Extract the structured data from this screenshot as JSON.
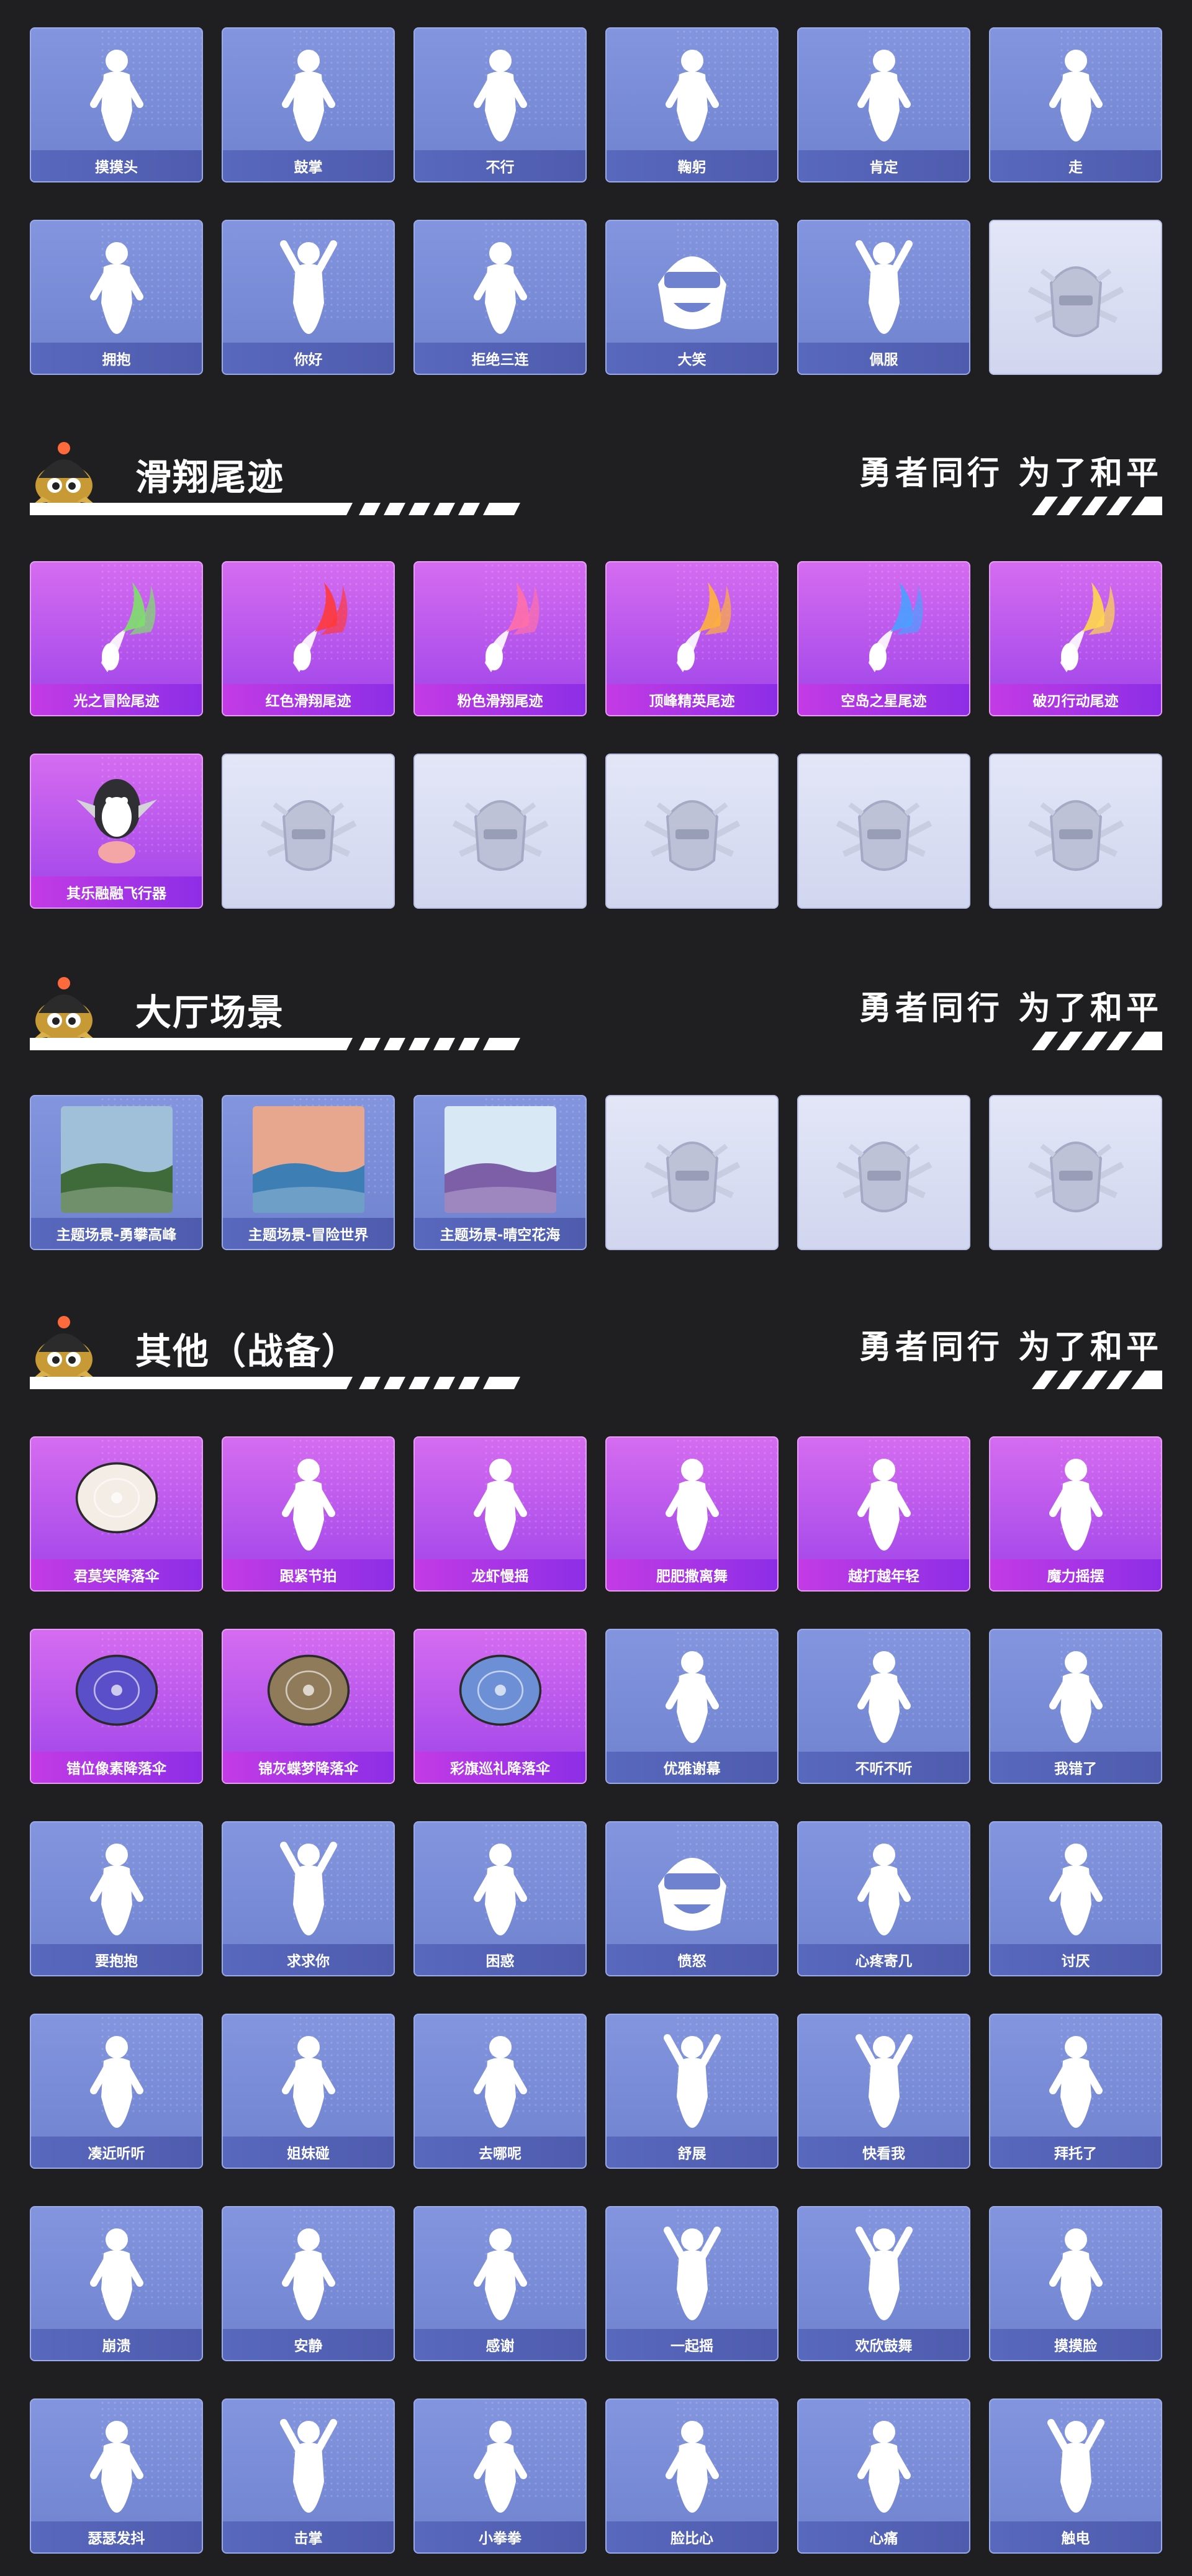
{
  "emotes_top": [
    {
      "label": "摸摸头",
      "style": "blue",
      "icon": "pointing-figure-icon"
    },
    {
      "label": "鼓掌",
      "style": "blue",
      "icon": "clapping-hands-icon"
    },
    {
      "label": "不行",
      "style": "blue",
      "icon": "head-shake-icon"
    },
    {
      "label": "鞠躬",
      "style": "blue",
      "icon": "bowing-figure-icon"
    },
    {
      "label": "肯定",
      "style": "blue",
      "icon": "nodding-head-icon"
    },
    {
      "label": "走",
      "style": "blue",
      "icon": "pointing-hand-icon"
    },
    {
      "label": "拥抱",
      "style": "blue",
      "icon": "hugging-figure-icon"
    },
    {
      "label": "你好",
      "style": "blue",
      "icon": "waving-figure-icon"
    },
    {
      "label": "拒绝三连",
      "style": "blue",
      "icon": "crossed-arms-icon"
    },
    {
      "label": "大笑",
      "style": "blue",
      "icon": "laughing-helmet-icon"
    },
    {
      "label": "佩服",
      "style": "blue",
      "icon": "admiring-figure-icon"
    },
    {
      "label": "",
      "style": "empty",
      "icon": "pubg-emblem-icon"
    }
  ],
  "sections": {
    "glide": {
      "title": "滑翔尾迹",
      "slogan": "勇者同行 为了和平"
    },
    "lobby": {
      "title": "大厅场景",
      "slogan": "勇者同行 为了和平"
    },
    "other": {
      "title": "其他（战备）",
      "slogan": "勇者同行 为了和平"
    }
  },
  "glide_trails": [
    {
      "label": "光之冒险尾迹",
      "style": "purple",
      "icon": "trail-green-icon",
      "color": "#7ee06a"
    },
    {
      "label": "红色滑翔尾迹",
      "style": "purple",
      "icon": "trail-red-icon",
      "color": "#ff3a3a"
    },
    {
      "label": "粉色滑翔尾迹",
      "style": "purple",
      "icon": "trail-pink-icon",
      "color": "#ff6fa8"
    },
    {
      "label": "顶峰精英尾迹",
      "style": "purple",
      "icon": "trail-rainbow-icon",
      "color": "#ffb13b"
    },
    {
      "label": "空岛之星尾迹",
      "style": "purple",
      "icon": "trail-star-icon",
      "color": "#4aa0ff"
    },
    {
      "label": "破刃行动尾迹",
      "style": "purple",
      "icon": "trail-multi-icon",
      "color": "#ffd84a"
    },
    {
      "label": "其乐融融飞行器",
      "style": "purple",
      "icon": "penguin-glider-icon",
      "color": "#333333"
    },
    {
      "label": "",
      "style": "empty",
      "icon": "pubg-emblem-icon"
    },
    {
      "label": "",
      "style": "empty",
      "icon": "pubg-emblem-icon"
    },
    {
      "label": "",
      "style": "empty",
      "icon": "pubg-emblem-icon"
    },
    {
      "label": "",
      "style": "empty",
      "icon": "pubg-emblem-icon"
    },
    {
      "label": "",
      "style": "empty",
      "icon": "pubg-emblem-icon"
    }
  ],
  "lobby_scenes": [
    {
      "label": "主题场景-勇攀高峰",
      "style": "scene",
      "icon": "mountain-scene-icon",
      "sky": "#9fc0d8",
      "ground": "#3f6b3a"
    },
    {
      "label": "主题场景-冒险世界",
      "style": "scene",
      "icon": "ocean-scene-icon",
      "sky": "#e7a78f",
      "ground": "#3d7fb5"
    },
    {
      "label": "主题场景-晴空花海",
      "style": "scene",
      "icon": "flower-field-scene-icon",
      "sky": "#d9e8f5",
      "ground": "#7d5fa8"
    },
    {
      "label": "",
      "style": "empty",
      "icon": "pubg-emblem-icon"
    },
    {
      "label": "",
      "style": "empty",
      "icon": "pubg-emblem-icon"
    },
    {
      "label": "",
      "style": "empty",
      "icon": "pubg-emblem-icon"
    }
  ],
  "others": [
    {
      "label": "君莫笑降落伞",
      "style": "purple",
      "icon": "parachute-icon",
      "color": "#f3ede6"
    },
    {
      "label": "跟紧节拍",
      "style": "purple",
      "icon": "dance-figure-icon"
    },
    {
      "label": "龙虾慢摇",
      "style": "purple",
      "icon": "dance-figure-icon"
    },
    {
      "label": "肥肥撒离舞",
      "style": "purple",
      "icon": "hat-dancer-icon"
    },
    {
      "label": "越打越年轻",
      "style": "purple",
      "icon": "music-dancer-icon"
    },
    {
      "label": "魔力摇摆",
      "style": "purple",
      "icon": "magic-dancer-icon"
    },
    {
      "label": "错位像素降落伞",
      "style": "purple",
      "icon": "parachute-icon",
      "color": "#5b4ec9"
    },
    {
      "label": "锦灰蝶梦降落伞",
      "style": "purple",
      "icon": "parachute-icon",
      "color": "#8f7a5a"
    },
    {
      "label": "彩旗巡礼降落伞",
      "style": "purple",
      "icon": "parachute-icon",
      "color": "#6d8fd6"
    },
    {
      "label": "优雅谢幕",
      "style": "blue",
      "icon": "bowing-figure-icon"
    },
    {
      "label": "不听不听",
      "style": "blue",
      "icon": "covering-ears-icon"
    },
    {
      "label": "我错了",
      "style": "blue",
      "icon": "apologizing-figure-icon"
    },
    {
      "label": "要抱抱",
      "style": "blue",
      "icon": "open-arms-icon"
    },
    {
      "label": "求求你",
      "style": "blue",
      "icon": "begging-figure-icon"
    },
    {
      "label": "困惑",
      "style": "blue",
      "icon": "confused-figure-icon"
    },
    {
      "label": "愤怒",
      "style": "blue",
      "icon": "angry-helmet-icon"
    },
    {
      "label": "心疼寄几",
      "style": "blue",
      "icon": "self-hug-icon"
    },
    {
      "label": "讨厌",
      "style": "blue",
      "icon": "annoyed-figure-icon"
    },
    {
      "label": "凑近听听",
      "style": "blue",
      "icon": "listening-figure-icon"
    },
    {
      "label": "姐妹碰",
      "style": "blue",
      "icon": "bump-figure-icon"
    },
    {
      "label": "去哪呢",
      "style": "blue",
      "icon": "wondering-figure-icon"
    },
    {
      "label": "舒展",
      "style": "blue",
      "icon": "stretching-figure-icon"
    },
    {
      "label": "快看我",
      "style": "blue",
      "icon": "look-at-me-icon"
    },
    {
      "label": "拜托了",
      "style": "blue",
      "icon": "praying-figure-icon"
    },
    {
      "label": "崩溃",
      "style": "blue",
      "icon": "collapsed-figure-icon"
    },
    {
      "label": "安静",
      "style": "blue",
      "icon": "shush-face-icon"
    },
    {
      "label": "感谢",
      "style": "blue",
      "icon": "heart-hands-icon"
    },
    {
      "label": "一起摇",
      "style": "blue",
      "icon": "swaying-figure-icon"
    },
    {
      "label": "欢欣鼓舞",
      "style": "blue",
      "icon": "cheering-figure-icon"
    },
    {
      "label": "摸摸脸",
      "style": "blue",
      "icon": "touch-face-icon"
    },
    {
      "label": "瑟瑟发抖",
      "style": "blue",
      "icon": "shivering-figure-icon"
    },
    {
      "label": "击掌",
      "style": "blue",
      "icon": "high-five-icon"
    },
    {
      "label": "小拳拳",
      "style": "blue",
      "icon": "fist-figure-icon"
    },
    {
      "label": "脸比心",
      "style": "blue",
      "icon": "face-heart-icon"
    },
    {
      "label": "心痛",
      "style": "blue",
      "icon": "heartache-figure-icon"
    },
    {
      "label": "触电",
      "style": "blue",
      "icon": "electrified-figure-icon"
    }
  ]
}
